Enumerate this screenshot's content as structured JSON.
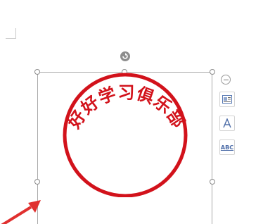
{
  "stamp": {
    "text": "好好学习俱乐部",
    "color": "#d2121b"
  },
  "toolbar": {
    "collapse_icon": "minus-circle-icon",
    "layout_icon": "layout-options-icon",
    "text_effects_icon": "text-effects-icon",
    "wordart_label": "ABC"
  },
  "colors": {
    "accent": "#d2121b",
    "frame": "#a9a9a9",
    "arrow": "#e0302f"
  }
}
